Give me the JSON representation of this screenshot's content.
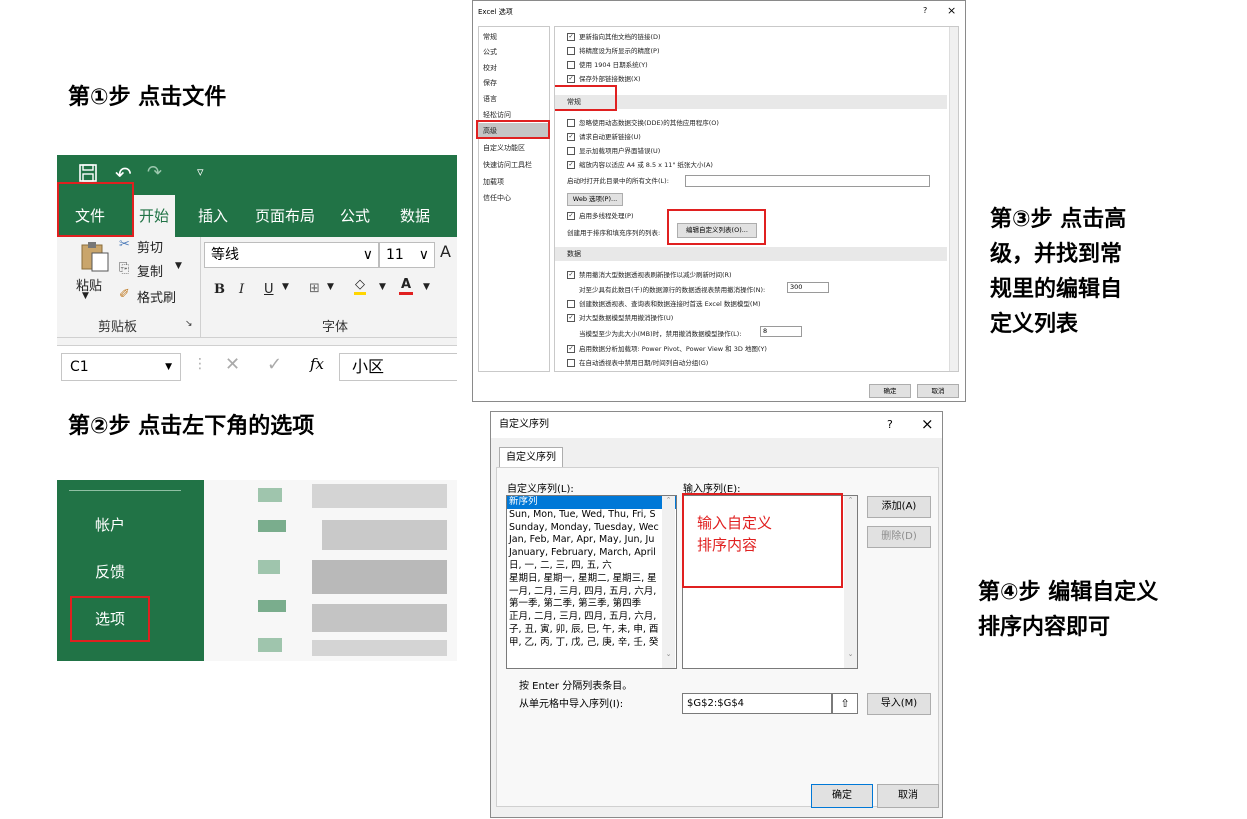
{
  "steps": {
    "step1": "第①步 点击文件",
    "step2": "第②步 点击左下角的选项",
    "step3_line1": "第③步 点击高",
    "step3_line2": "级，并找到常",
    "step3_line3": "规里的编辑自",
    "step3_line4": "定义列表",
    "step4_line1": "第④步 编辑自定义",
    "step4_line2": "排序内容即可"
  },
  "colors": {
    "excel_green": "#217346",
    "highlight_red": "#e02020",
    "selection_blue": "#0078d7"
  },
  "ribbon": {
    "qat_icons": [
      "save-icon",
      "undo-icon",
      "redo-icon",
      "customize-icon"
    ],
    "tabs": [
      "文件",
      "开始",
      "插入",
      "页面布局",
      "公式",
      "数据"
    ],
    "active_tab": "开始",
    "clipboard": {
      "paste": "粘贴",
      "cut": "剪切",
      "copy": "复制",
      "format_painter": "格式刷",
      "group": "剪贴板"
    },
    "font": {
      "name": "等线",
      "size": "11",
      "bold": "B",
      "italic": "I",
      "underline": "U",
      "group": "字体"
    },
    "formula_bar": {
      "name_box": "C1",
      "fx": "fx",
      "value": "小区"
    }
  },
  "backstage": {
    "items": [
      "帐户",
      "反馈",
      "选项"
    ]
  },
  "options_dialog": {
    "title": "Excel 选项",
    "help": "?",
    "close": "×",
    "nav": [
      "常规",
      "公式",
      "校对",
      "保存",
      "语言",
      "轻松访问",
      "高级",
      "自定义功能区",
      "快速访问工具栏",
      "加载项",
      "信任中心"
    ],
    "selected_nav": "高级",
    "rows_top": [
      {
        "checked": true,
        "text": "更新指向其他文档的链接(D)"
      },
      {
        "checked": false,
        "text": "将精度设为所显示的精度(P)"
      },
      {
        "checked": false,
        "text": "使用 1904 日期系统(Y)"
      },
      {
        "checked": true,
        "text": "保存外部链接数据(X)"
      }
    ],
    "section_general": "常规",
    "rows_general": [
      {
        "checked": false,
        "text": "忽略使用动态数据交换(DDE)的其他应用程序(O)"
      },
      {
        "checked": true,
        "text": "请求自动更新链接(U)"
      },
      {
        "checked": false,
        "text": "显示加载项用户界面错误(U)"
      },
      {
        "checked": true,
        "text": "缩放内容以适应 A4 或 8.5 x 11\" 纸张大小(A)"
      }
    ],
    "startup_label": "启动时打开此目录中的所有文件(L):",
    "web_options": "Web 选项(P)...",
    "multithread": "启用多线程处理(P)",
    "create_lists_label": "创建用于排序和填充序列的列表:",
    "edit_custom_lists": "编辑自定义列表(O)...",
    "section_data": "数据",
    "rows_data": [
      {
        "checked": true,
        "text": "禁用撤消大型数据透视表刷新操作以减少刷新时间(R)"
      },
      {
        "checked": null,
        "text": "对至少具有此数目(千)的数据源行的数据透视表禁用撤消操作(N):",
        "value": "300"
      },
      {
        "checked": false,
        "text": "创建数据透视表、查询表和数据连接时首选 Excel 数据模型(M)"
      },
      {
        "checked": true,
        "text": "对大型数据模型禁用撤消操作(U)"
      },
      {
        "checked": null,
        "text": "当模型至少为此大小(MB)时，禁用撤消数据模型操作(L):",
        "value": "8"
      },
      {
        "checked": true,
        "text": "启用数据分析加载项: Power Pivot、Power View 和 3D 地图(Y)"
      },
      {
        "checked": false,
        "text": "在自动透视表中禁用日期/时间列自动分组(G)"
      }
    ],
    "ok": "确定",
    "cancel": "取消"
  },
  "custom_lists_dialog": {
    "title": "自定义序列",
    "help": "?",
    "close": "×",
    "tab": "自定义序列",
    "lists_label": "自定义序列(L):",
    "entries_label": "输入序列(E):",
    "lists": [
      "新序列",
      "Sun, Mon, Tue, Wed, Thu, Fri, S",
      "Sunday, Monday, Tuesday, Wec",
      "Jan, Feb, Mar, Apr, May, Jun, Ju",
      "January, February, March, April",
      "日, 一, 二, 三, 四, 五, 六",
      "星期日, 星期一, 星期二, 星期三, 星",
      "一月, 二月, 三月, 四月, 五月, 六月,",
      "第一季, 第二季, 第三季, 第四季",
      "正月, 二月, 三月, 四月, 五月, 六月,",
      "子, 丑, 寅, 卯, 辰, 巳, 午, 未, 申, 酉",
      "甲, 乙, 丙, 丁, 戊, 己, 庚, 辛, 壬, 癸"
    ],
    "annotation": "输入自定义排序内容",
    "annotation_line1": "输入自定义",
    "annotation_line2": "排序内容",
    "add": "添加(A)",
    "delete": "删除(D)",
    "hint": "按 Enter 分隔列表条目。",
    "import_label": "从单元格中导入序列(I):",
    "import_range": "$G$2:$G$4",
    "import": "导入(M)",
    "ok": "确定",
    "cancel": "取消"
  }
}
